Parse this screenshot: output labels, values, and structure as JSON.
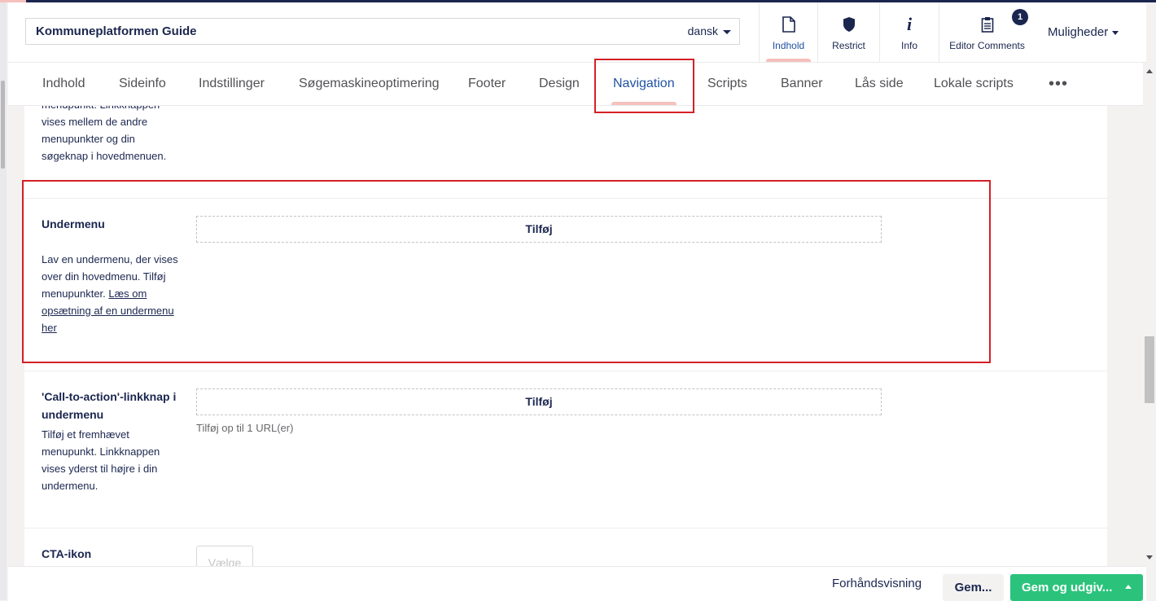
{
  "header": {
    "page_name": "Kommuneplatformen Guide",
    "language": "dansk",
    "buttons": [
      {
        "label": "Indhold",
        "icon": "document-icon"
      },
      {
        "label": "Restrict",
        "icon": "shield-icon"
      },
      {
        "label": "Info",
        "icon": "info-icon"
      },
      {
        "label": "Editor Comments",
        "icon": "clipboard-icon",
        "badge": "1"
      }
    ],
    "actions_label": "Muligheder"
  },
  "tabs": [
    {
      "label": "Indhold"
    },
    {
      "label": "Sideinfo"
    },
    {
      "label": "Indstillinger"
    },
    {
      "label": "Søgemaskineoptimering"
    },
    {
      "label": "Footer"
    },
    {
      "label": "Design"
    },
    {
      "label": "Navigation",
      "active": true
    },
    {
      "label": "Scripts"
    },
    {
      "label": "Banner"
    },
    {
      "label": "Lås side"
    },
    {
      "label": "Lokale scripts"
    }
  ],
  "more_label": "•••",
  "content": {
    "prev_desc_lines": [
      "menupunkt. Linkknappen",
      "vises mellem de andre",
      "menupunkter og din",
      "søgeknap i hovedmenuen."
    ],
    "undermenu": {
      "label": "Undermenu",
      "desc": "Lav en undermenu, der vises over din hovedmenu. Tilføj menupunkter. ",
      "link": "Læs om opsætning af en undermenu her",
      "add_label": "Tilføj"
    },
    "cta": {
      "label": "'Call-to-action'-linkknap i undermenu",
      "desc": "Tilføj et fremhævet menupunkt. Linkknappen vises yderst til højre i din undermenu.",
      "add_label": "Tilføj",
      "helper": "Tilføj op til 1 URL(er)"
    },
    "cta_icon": {
      "label": "CTA-ikon",
      "select_label": "Vælge"
    }
  },
  "footer": {
    "preview_label": "Forhåndsvisning",
    "save_label": "Gem...",
    "publish_label": "Gem og udgiv..."
  },
  "colors": {
    "navy": "#1b264f",
    "accent_pink": "#f5c1bc",
    "active_blue": "#2152a3",
    "publish_green": "#2bc37c",
    "highlight_red": "#d42027"
  }
}
